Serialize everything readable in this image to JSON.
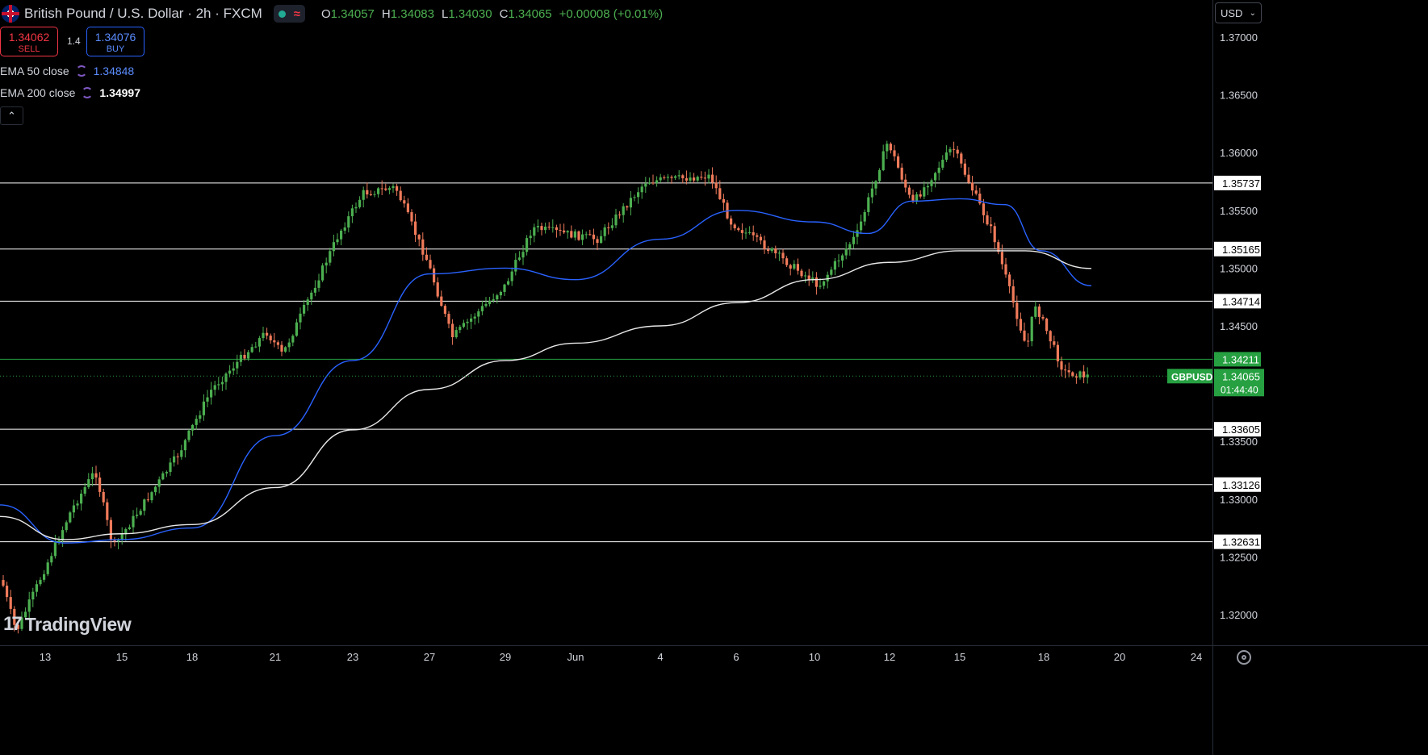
{
  "header": {
    "title": "British Pound / U.S. Dollar · 2h · FXCM",
    "ohlc": [
      {
        "k": "O",
        "v": "1.34057"
      },
      {
        "k": "H",
        "v": "1.34083"
      },
      {
        "k": "L",
        "v": "1.34030"
      },
      {
        "k": "C",
        "v": "1.34065"
      },
      {
        "k": "",
        "v": "+0.00008 (+0.01%)"
      }
    ]
  },
  "trade": {
    "sell_price": "1.34062",
    "sell_label": "SELL",
    "buy_price": "1.34076",
    "buy_label": "BUY",
    "spread": "1.4"
  },
  "indicators": [
    {
      "label": "EMA 50 close",
      "value": "1.34848",
      "color": "#5b8cff"
    },
    {
      "label": "EMA 200 close",
      "value": "1.34997",
      "color": "#ffffff"
    }
  ],
  "currency": "USD",
  "brand": "TradingView",
  "colors": {
    "up": "#26a69a",
    "up_candle": "#4caf50",
    "down": "#ef7a5a",
    "ema50": "#2962ff",
    "ema200": "#e8e8e8",
    "price_tag": "#26a041",
    "grid": "#000000"
  },
  "chart_data": {
    "type": "candlestick",
    "symbol": "GBPUSD",
    "interval": "2h",
    "ylim": [
      1.3176,
      1.3716
    ],
    "y_ticks": [
      "1.37000",
      "1.36500",
      "1.36000",
      "1.35500",
      "1.35000",
      "1.34500",
      "1.33500",
      "1.33000",
      "1.32500",
      "1.32000"
    ],
    "x_ticks": [
      "13",
      "15",
      "18",
      "21",
      "23",
      "27",
      "29",
      "Jun",
      "4",
      "6",
      "10",
      "12",
      "15",
      "18",
      "20",
      "24"
    ],
    "horizontal_levels": [
      "1.35737",
      "1.35165",
      "1.34714",
      "1.34211",
      "1.33605",
      "1.33126",
      "1.32631"
    ],
    "last_price": "1.34065",
    "countdown": "01:44:40",
    "path_keypoints": [
      [
        "13",
        1.323
      ],
      [
        "13",
        1.3185
      ],
      [
        "15",
        1.329
      ],
      [
        "15",
        1.3325
      ],
      [
        "18",
        1.3258
      ],
      [
        "18",
        1.334
      ],
      [
        "21",
        1.3395
      ],
      [
        "21",
        1.3445
      ],
      [
        "23",
        1.3425
      ],
      [
        "23",
        1.353
      ],
      [
        "27",
        1.3565
      ],
      [
        "27",
        1.357
      ],
      [
        "29",
        1.3505
      ],
      [
        "29",
        1.344
      ],
      [
        "Jun",
        1.3485
      ],
      [
        "Jun",
        1.3535
      ],
      [
        "4",
        1.3525
      ],
      [
        "6",
        1.3575
      ],
      [
        "6",
        1.358
      ],
      [
        "10",
        1.354
      ],
      [
        "10",
        1.3485
      ],
      [
        "12",
        1.353
      ],
      [
        "12",
        1.361
      ],
      [
        "15",
        1.3555
      ],
      [
        "15",
        1.3605
      ],
      [
        "18",
        1.353
      ],
      [
        "18",
        1.343
      ],
      [
        "18",
        1.347
      ],
      [
        "18",
        1.341
      ],
      [
        "18",
        1.34065
      ]
    ],
    "ema50_keypoints": [
      [
        "13",
        1.3295
      ],
      [
        "13",
        1.3262
      ],
      [
        "15",
        1.3265
      ],
      [
        "18",
        1.3275
      ],
      [
        "21",
        1.3355
      ],
      [
        "23",
        1.342
      ],
      [
        "27",
        1.3495
      ],
      [
        "29",
        1.35
      ],
      [
        "Jun",
        1.349
      ],
      [
        "4",
        1.3525
      ],
      [
        "6",
        1.355
      ],
      [
        "10",
        1.354
      ],
      [
        "12",
        1.353
      ],
      [
        "12",
        1.3558
      ],
      [
        "15",
        1.356
      ],
      [
        "18",
        1.3555
      ],
      [
        "18",
        1.3515
      ],
      [
        "18",
        1.34848
      ]
    ],
    "ema200_keypoints": [
      [
        "13",
        1.3285
      ],
      [
        "13",
        1.3265
      ],
      [
        "15",
        1.327
      ],
      [
        "18",
        1.3278
      ],
      [
        "21",
        1.331
      ],
      [
        "23",
        1.336
      ],
      [
        "27",
        1.3395
      ],
      [
        "29",
        1.342
      ],
      [
        "Jun",
        1.3435
      ],
      [
        "4",
        1.345
      ],
      [
        "6",
        1.347
      ],
      [
        "10",
        1.349
      ],
      [
        "12",
        1.3505
      ],
      [
        "15",
        1.3515
      ],
      [
        "18",
        1.3515
      ],
      [
        "18",
        1.34997
      ]
    ]
  }
}
